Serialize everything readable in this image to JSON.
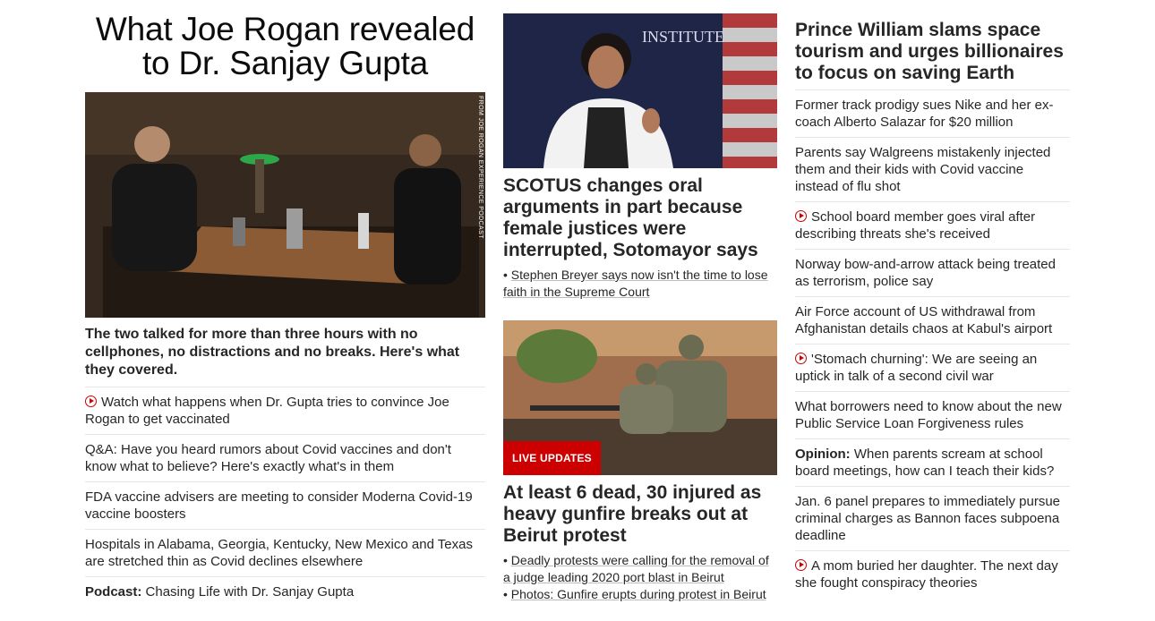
{
  "col1": {
    "title": "What Joe Rogan revealed to Dr. Sanjay Gupta",
    "photo_credit": "FROM JOE ROGAN EXPERIENCE PODCAST",
    "description": "The two talked for more than three hours with no cellphones, no distractions and no breaks. Here's what they covered.",
    "items": [
      {
        "video": true,
        "text": "Watch what happens when Dr. Gupta tries to convince Joe Rogan to get vaccinated"
      },
      {
        "text": "Q&A: Have you heard rumors about Covid vaccines and don't know what to believe? Here's exactly what's in them"
      },
      {
        "text": "FDA vaccine advisers are meeting to consider Moderna Covid-19 vaccine boosters"
      },
      {
        "text": "Hospitals in Alabama, Georgia, Kentucky, New Mexico and Texas are stretched thin as Covid declines elsewhere"
      },
      {
        "prefix": "Podcast:",
        "text": "Chasing Life with Dr. Sanjay Gupta"
      }
    ]
  },
  "col2": {
    "story1": {
      "photo_text": "INSTITUTE",
      "headline": "SCOTUS changes oral arguments in part because female justices were interrupted, Sotomayor says",
      "subs": [
        "Stephen Breyer says now isn't the time to lose faith in the Supreme Court"
      ]
    },
    "story2": {
      "badge": "LIVE UPDATES",
      "headline": "At least 6 dead, 30 injured as heavy gunfire breaks out at Beirut protest",
      "subs": [
        "Deadly protests were calling for the removal of a judge leading 2020 port blast in Beirut",
        "Photos: Gunfire erupts during protest in Beirut"
      ]
    }
  },
  "col3": {
    "title": "Prince William slams space tourism and urges billionaires to focus on saving Earth",
    "items": [
      {
        "text": "Former track prodigy sues Nike and her ex-coach Alberto Salazar for $20 million"
      },
      {
        "text": "Parents say Walgreens mistakenly injected them and their kids with Covid vaccine instead of flu shot"
      },
      {
        "video": true,
        "text": "School board member goes viral after describing threats she's received"
      },
      {
        "text": "Norway bow-and-arrow attack being treated as terrorism, police say"
      },
      {
        "text": "Air Force account of US withdrawal from Afghanistan details chaos at Kabul's airport"
      },
      {
        "video": true,
        "text": "'Stomach churning': We are seeing an uptick in talk of a second civil war"
      },
      {
        "text": "What borrowers need to know about the new Public Service Loan Forgiveness rules"
      },
      {
        "prefix": "Opinion:",
        "text": "When parents scream at school board meetings, how can I teach their kids?"
      },
      {
        "text": "Jan. 6 panel prepares to immediately pursue criminal charges as Bannon faces subpoena deadline"
      },
      {
        "video": true,
        "text": "A mom buried her daughter. The next day she fought conspiracy theories"
      }
    ]
  },
  "colors": {
    "accent": "#cc0000",
    "text": "#262626",
    "divider": "#e6e6e6"
  }
}
